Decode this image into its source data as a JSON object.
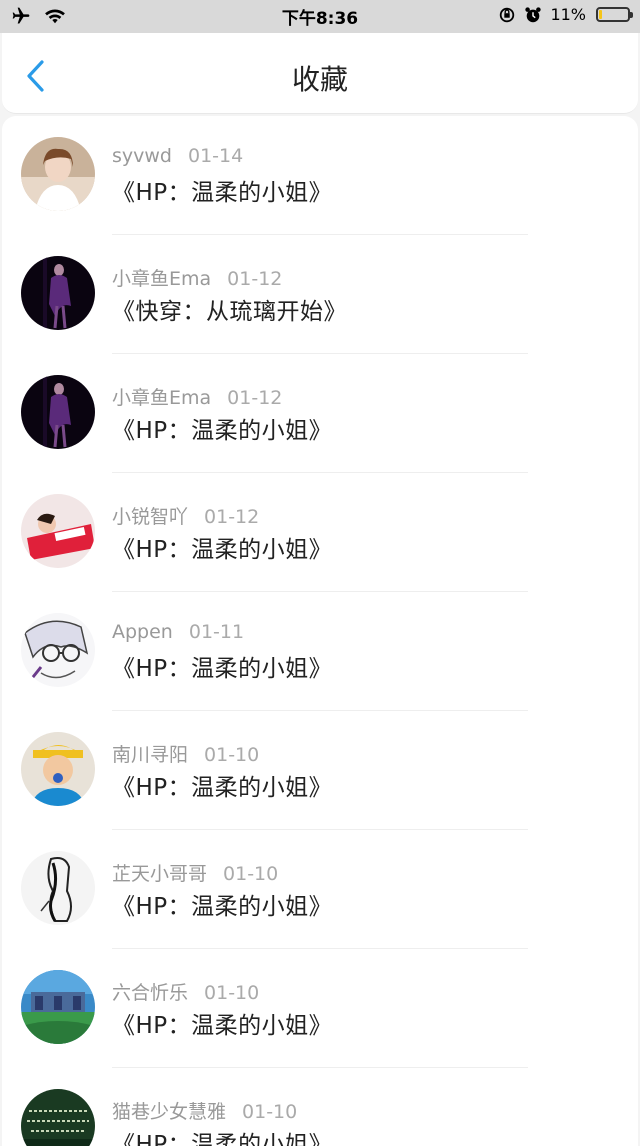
{
  "status_bar": {
    "time": "下午8:36",
    "battery": "11%",
    "battery_level": 0.11,
    "battery_color": "#f5c518",
    "icons": [
      "airplane-icon",
      "wifi-icon",
      "orientation-lock-icon",
      "alarm-icon",
      "battery-icon"
    ]
  },
  "nav": {
    "title": "收藏",
    "back_icon": "chevron-left-icon",
    "accent": "#2a9be8"
  },
  "items": [
    {
      "user": "syvwd",
      "date": "01-14",
      "book": "《HP：温柔的小姐》"
    },
    {
      "user": "小章鱼Ema",
      "date": "01-12",
      "book": "《快穿：从琉璃开始》"
    },
    {
      "user": "小章鱼Ema",
      "date": "01-12",
      "book": "《HP：温柔的小姐》"
    },
    {
      "user": "小锐智吖",
      "date": "01-12",
      "book": "《HP：温柔的小姐》"
    },
    {
      "user": "Appen",
      "date": "01-11",
      "book": "《HP：温柔的小姐》"
    },
    {
      "user": "南川寻阳",
      "date": "01-10",
      "book": "《HP：温柔的小姐》"
    },
    {
      "user": "芷天小哥哥",
      "date": "01-10",
      "book": "《HP：温柔的小姐》"
    },
    {
      "user": "六合忻乐",
      "date": "01-10",
      "book": "《HP：温柔的小姐》"
    },
    {
      "user": "猫巷少女慧雅",
      "date": "01-10",
      "book": "《HP：温柔的小姐》"
    }
  ]
}
